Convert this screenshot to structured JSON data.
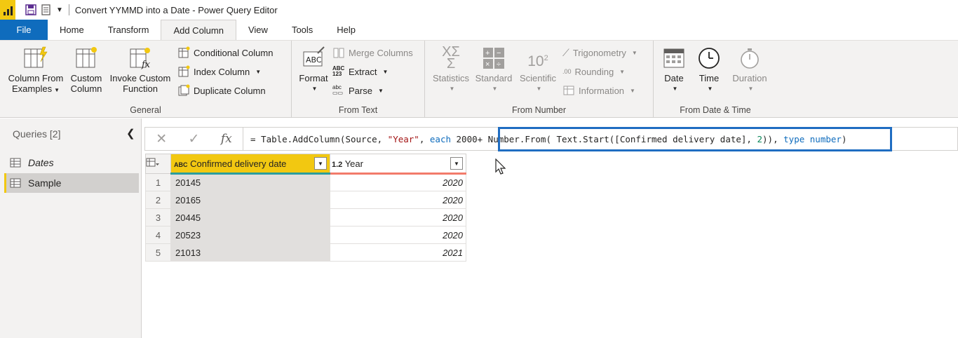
{
  "window": {
    "title": "Convert YYMMD into a Date - Power Query Editor"
  },
  "tabs": [
    "File",
    "Home",
    "Transform",
    "Add Column",
    "View",
    "Tools",
    "Help"
  ],
  "ribbon": {
    "general": {
      "label": "General",
      "column_from_examples": [
        "Column From",
        "Examples"
      ],
      "custom_column": [
        "Custom",
        "Column"
      ],
      "invoke_custom_function": [
        "Invoke Custom",
        "Function"
      ],
      "conditional_column": "Conditional Column",
      "index_column": "Index Column",
      "duplicate_column": "Duplicate Column"
    },
    "from_text": {
      "label": "From Text",
      "format": "Format",
      "merge_columns": "Merge Columns",
      "extract": "Extract",
      "parse": "Parse"
    },
    "from_number": {
      "label": "From Number",
      "statistics": "Statistics",
      "standard": "Standard",
      "scientific": "Scientific",
      "trigonometry": "Trigonometry",
      "rounding": "Rounding",
      "information": "Information"
    },
    "from_date_time": {
      "label": "From Date & Time",
      "date": "Date",
      "time": "Time",
      "duration": "Duration"
    }
  },
  "queries": {
    "header": "Queries [2]",
    "items": [
      "Dates",
      "Sample"
    ]
  },
  "formula": {
    "parts": {
      "p1": "= Table.AddColumn(Source, ",
      "p2": "\"Year\"",
      "p3": ", ",
      "p4": "each",
      "p5": " 2000+ Number.From( Text.Start([Confirmed delivery date], ",
      "p6": "2",
      "p7": ")), ",
      "p8": "type number",
      "p9": ")"
    }
  },
  "table": {
    "columns": [
      {
        "type": "ABC",
        "name": "Confirmed delivery date"
      },
      {
        "type": "1.2",
        "name": "Year"
      }
    ],
    "rows": [
      {
        "n": "1",
        "date": "20145",
        "year": "2020"
      },
      {
        "n": "2",
        "date": "20165",
        "year": "2020"
      },
      {
        "n": "3",
        "date": "20445",
        "year": "2020"
      },
      {
        "n": "4",
        "date": "20523",
        "year": "2020"
      },
      {
        "n": "5",
        "date": "21013",
        "year": "2021"
      }
    ]
  }
}
